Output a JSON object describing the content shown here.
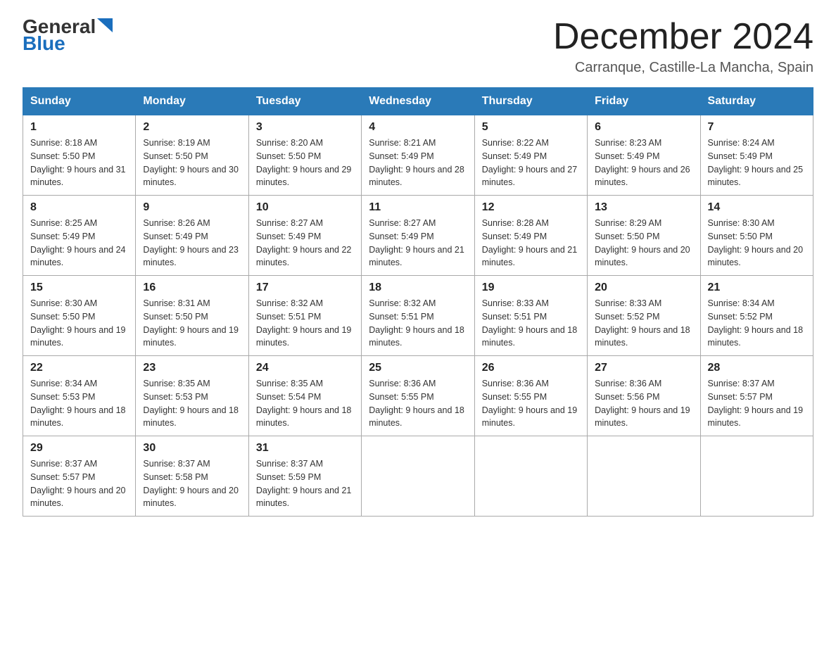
{
  "header": {
    "logo_general": "General",
    "logo_blue": "Blue",
    "month_title": "December 2024",
    "location": "Carranque, Castille-La Mancha, Spain"
  },
  "weekdays": [
    "Sunday",
    "Monday",
    "Tuesday",
    "Wednesday",
    "Thursday",
    "Friday",
    "Saturday"
  ],
  "weeks": [
    [
      {
        "day": "1",
        "sunrise": "8:18 AM",
        "sunset": "5:50 PM",
        "daylight": "9 hours and 31 minutes."
      },
      {
        "day": "2",
        "sunrise": "8:19 AM",
        "sunset": "5:50 PM",
        "daylight": "9 hours and 30 minutes."
      },
      {
        "day": "3",
        "sunrise": "8:20 AM",
        "sunset": "5:50 PM",
        "daylight": "9 hours and 29 minutes."
      },
      {
        "day": "4",
        "sunrise": "8:21 AM",
        "sunset": "5:49 PM",
        "daylight": "9 hours and 28 minutes."
      },
      {
        "day": "5",
        "sunrise": "8:22 AM",
        "sunset": "5:49 PM",
        "daylight": "9 hours and 27 minutes."
      },
      {
        "day": "6",
        "sunrise": "8:23 AM",
        "sunset": "5:49 PM",
        "daylight": "9 hours and 26 minutes."
      },
      {
        "day": "7",
        "sunrise": "8:24 AM",
        "sunset": "5:49 PM",
        "daylight": "9 hours and 25 minutes."
      }
    ],
    [
      {
        "day": "8",
        "sunrise": "8:25 AM",
        "sunset": "5:49 PM",
        "daylight": "9 hours and 24 minutes."
      },
      {
        "day": "9",
        "sunrise": "8:26 AM",
        "sunset": "5:49 PM",
        "daylight": "9 hours and 23 minutes."
      },
      {
        "day": "10",
        "sunrise": "8:27 AM",
        "sunset": "5:49 PM",
        "daylight": "9 hours and 22 minutes."
      },
      {
        "day": "11",
        "sunrise": "8:27 AM",
        "sunset": "5:49 PM",
        "daylight": "9 hours and 21 minutes."
      },
      {
        "day": "12",
        "sunrise": "8:28 AM",
        "sunset": "5:49 PM",
        "daylight": "9 hours and 21 minutes."
      },
      {
        "day": "13",
        "sunrise": "8:29 AM",
        "sunset": "5:50 PM",
        "daylight": "9 hours and 20 minutes."
      },
      {
        "day": "14",
        "sunrise": "8:30 AM",
        "sunset": "5:50 PM",
        "daylight": "9 hours and 20 minutes."
      }
    ],
    [
      {
        "day": "15",
        "sunrise": "8:30 AM",
        "sunset": "5:50 PM",
        "daylight": "9 hours and 19 minutes."
      },
      {
        "day": "16",
        "sunrise": "8:31 AM",
        "sunset": "5:50 PM",
        "daylight": "9 hours and 19 minutes."
      },
      {
        "day": "17",
        "sunrise": "8:32 AM",
        "sunset": "5:51 PM",
        "daylight": "9 hours and 19 minutes."
      },
      {
        "day": "18",
        "sunrise": "8:32 AM",
        "sunset": "5:51 PM",
        "daylight": "9 hours and 18 minutes."
      },
      {
        "day": "19",
        "sunrise": "8:33 AM",
        "sunset": "5:51 PM",
        "daylight": "9 hours and 18 minutes."
      },
      {
        "day": "20",
        "sunrise": "8:33 AM",
        "sunset": "5:52 PM",
        "daylight": "9 hours and 18 minutes."
      },
      {
        "day": "21",
        "sunrise": "8:34 AM",
        "sunset": "5:52 PM",
        "daylight": "9 hours and 18 minutes."
      }
    ],
    [
      {
        "day": "22",
        "sunrise": "8:34 AM",
        "sunset": "5:53 PM",
        "daylight": "9 hours and 18 minutes."
      },
      {
        "day": "23",
        "sunrise": "8:35 AM",
        "sunset": "5:53 PM",
        "daylight": "9 hours and 18 minutes."
      },
      {
        "day": "24",
        "sunrise": "8:35 AM",
        "sunset": "5:54 PM",
        "daylight": "9 hours and 18 minutes."
      },
      {
        "day": "25",
        "sunrise": "8:36 AM",
        "sunset": "5:55 PM",
        "daylight": "9 hours and 18 minutes."
      },
      {
        "day": "26",
        "sunrise": "8:36 AM",
        "sunset": "5:55 PM",
        "daylight": "9 hours and 19 minutes."
      },
      {
        "day": "27",
        "sunrise": "8:36 AM",
        "sunset": "5:56 PM",
        "daylight": "9 hours and 19 minutes."
      },
      {
        "day": "28",
        "sunrise": "8:37 AM",
        "sunset": "5:57 PM",
        "daylight": "9 hours and 19 minutes."
      }
    ],
    [
      {
        "day": "29",
        "sunrise": "8:37 AM",
        "sunset": "5:57 PM",
        "daylight": "9 hours and 20 minutes."
      },
      {
        "day": "30",
        "sunrise": "8:37 AM",
        "sunset": "5:58 PM",
        "daylight": "9 hours and 20 minutes."
      },
      {
        "day": "31",
        "sunrise": "8:37 AM",
        "sunset": "5:59 PM",
        "daylight": "9 hours and 21 minutes."
      },
      null,
      null,
      null,
      null
    ]
  ]
}
